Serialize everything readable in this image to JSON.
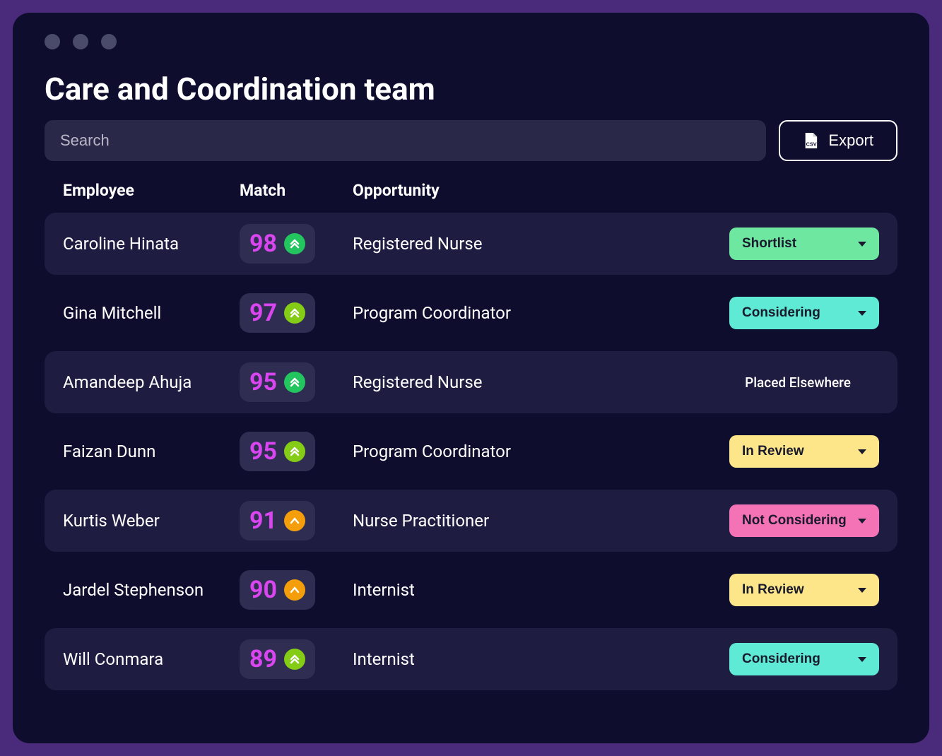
{
  "page_title": "Care and Coordination team",
  "search": {
    "placeholder": "Search",
    "value": ""
  },
  "export_label": "Export",
  "columns": {
    "employee": "Employee",
    "match": "Match",
    "opportunity": "Opportunity"
  },
  "rows": [
    {
      "employee": "Caroline Hinata",
      "match": 98,
      "trend": "double-up",
      "trend_color": "green",
      "opportunity": "Registered Nurse",
      "status": "Shortlist",
      "status_style": "shortlist",
      "shaded": true
    },
    {
      "employee": "Gina Mitchell",
      "match": 97,
      "trend": "double-up",
      "trend_color": "lime",
      "opportunity": "Program Coordinator",
      "status": "Considering",
      "status_style": "considering",
      "shaded": false
    },
    {
      "employee": "Amandeep Ahuja",
      "match": 95,
      "trend": "double-up",
      "trend_color": "green",
      "opportunity": "Registered Nurse",
      "status": "Placed Elsewhere",
      "status_style": "text",
      "shaded": true
    },
    {
      "employee": "Faizan Dunn",
      "match": 95,
      "trend": "double-up",
      "trend_color": "lime",
      "opportunity": "Program Coordinator",
      "status": "In Review",
      "status_style": "review",
      "shaded": false
    },
    {
      "employee": "Kurtis Weber",
      "match": 91,
      "trend": "up",
      "trend_color": "orange",
      "opportunity": "Nurse Practitioner",
      "status": "Not Considering",
      "status_style": "notconsidering",
      "shaded": true
    },
    {
      "employee": "Jardel Stephenson",
      "match": 90,
      "trend": "up",
      "trend_color": "orange",
      "opportunity": "Internist",
      "status": "In Review",
      "status_style": "review",
      "shaded": false
    },
    {
      "employee": "Will Conmara",
      "match": 89,
      "trend": "double-up",
      "trend_color": "lime",
      "opportunity": "Internist",
      "status": "Considering",
      "status_style": "considering",
      "shaded": true
    }
  ]
}
